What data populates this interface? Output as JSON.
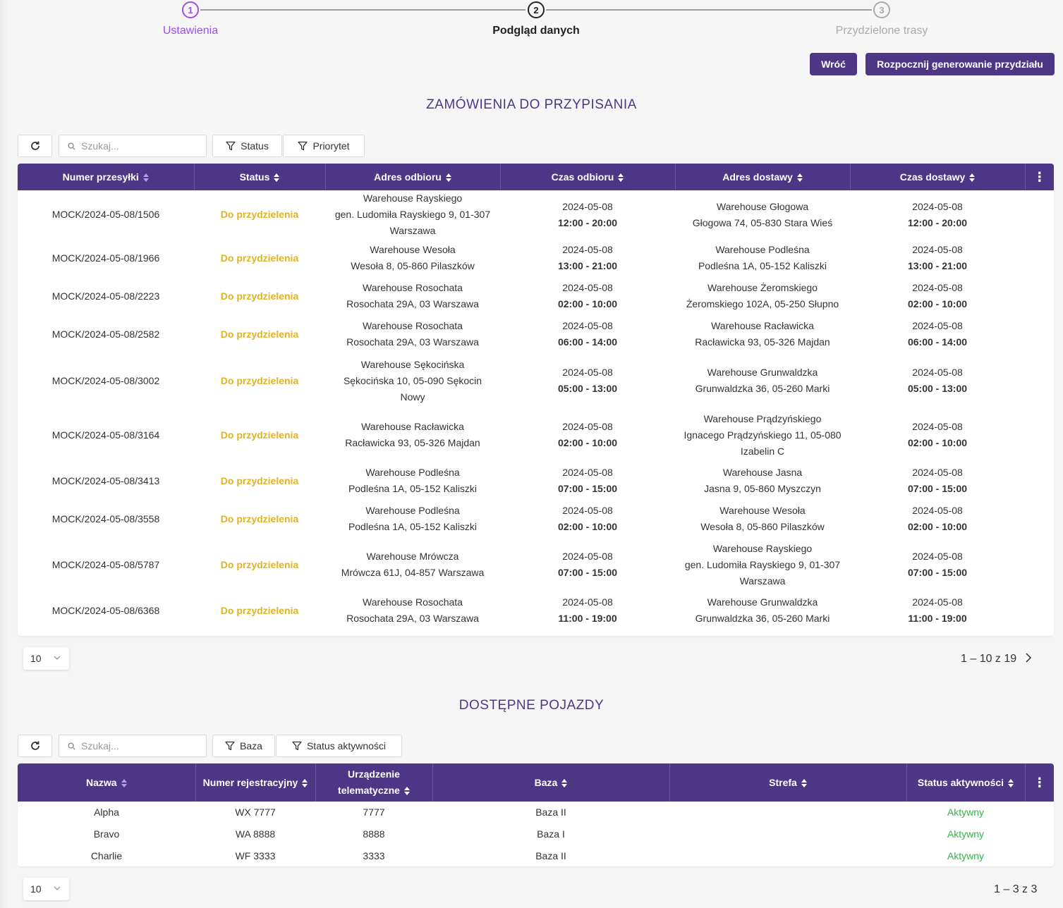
{
  "stepper": {
    "steps": [
      {
        "number": "1",
        "label": "Ustawienia",
        "state": "done"
      },
      {
        "number": "2",
        "label": "Podgląd danych",
        "state": "current"
      },
      {
        "number": "3",
        "label": "Przydzielone trasy",
        "state": "upcoming"
      }
    ]
  },
  "actions": {
    "back_label": "Wróć",
    "start_label": "Rozpocznij generowanie przydziału"
  },
  "orders": {
    "title": "ZAMÓWIENIA DO PRZYPISANIA",
    "search_placeholder": "Szukaj...",
    "filters": [
      "Status",
      "Priorytet"
    ],
    "columns": [
      "Numer przesyłki",
      "Status",
      "Adres odbioru",
      "Czas odbioru",
      "Adres dostawy",
      "Czas dostawy"
    ],
    "rows": [
      {
        "id": "MOCK/2024-05-08/1506",
        "status": "Do przydzielenia",
        "pickup_address": [
          "Warehouse Rayskiego",
          "gen. Ludomiła Rayskiego 9, 01-307",
          "Warszawa"
        ],
        "pickup_date": "2024-05-08",
        "pickup_time": "12:00 - 20:00",
        "delivery_address": [
          "Warehouse Głogowa",
          "Głogowa 74, 05-830 Stara Wieś"
        ],
        "delivery_date": "2024-05-08",
        "delivery_time": "12:00 - 20:00"
      },
      {
        "id": "MOCK/2024-05-08/1966",
        "status": "Do przydzielenia",
        "pickup_address": [
          "Warehouse Wesoła",
          "Wesoła 8, 05-860 Pilaszków"
        ],
        "pickup_date": "2024-05-08",
        "pickup_time": "13:00 - 21:00",
        "delivery_address": [
          "Warehouse Podleśna",
          "Podleśna 1A, 05-152 Kaliszki"
        ],
        "delivery_date": "2024-05-08",
        "delivery_time": "13:00 - 21:00"
      },
      {
        "id": "MOCK/2024-05-08/2223",
        "status": "Do przydzielenia",
        "pickup_address": [
          "Warehouse Rosochata",
          "Rosochata 29A, 03 Warszawa"
        ],
        "pickup_date": "2024-05-08",
        "pickup_time": "02:00 - 10:00",
        "delivery_address": [
          "Warehouse Żeromskiego",
          "Żeromskiego 102A, 05-250 Słupno"
        ],
        "delivery_date": "2024-05-08",
        "delivery_time": "02:00 - 10:00"
      },
      {
        "id": "MOCK/2024-05-08/2582",
        "status": "Do przydzielenia",
        "pickup_address": [
          "Warehouse Rosochata",
          "Rosochata 29A, 03 Warszawa"
        ],
        "pickup_date": "2024-05-08",
        "pickup_time": "06:00 - 14:00",
        "delivery_address": [
          "Warehouse Racławicka",
          "Racławicka 93, 05-326 Majdan"
        ],
        "delivery_date": "2024-05-08",
        "delivery_time": "06:00 - 14:00"
      },
      {
        "id": "MOCK/2024-05-08/3002",
        "status": "Do przydzielenia",
        "pickup_address": [
          "Warehouse Sękocińska",
          "Sękocińska 10, 05-090 Sękocin",
          "Nowy"
        ],
        "pickup_date": "2024-05-08",
        "pickup_time": "05:00 - 13:00",
        "delivery_address": [
          "Warehouse Grunwaldzka",
          "Grunwaldzka 36, 05-260 Marki"
        ],
        "delivery_date": "2024-05-08",
        "delivery_time": "05:00 - 13:00"
      },
      {
        "id": "MOCK/2024-05-08/3164",
        "status": "Do przydzielenia",
        "pickup_address": [
          "Warehouse Racławicka",
          "Racławicka 93, 05-326 Majdan"
        ],
        "pickup_date": "2024-05-08",
        "pickup_time": "02:00 - 10:00",
        "delivery_address": [
          "Warehouse Prądzyńskiego",
          "Ignacego Prądzyńskiego 11, 05-080",
          "Izabelin C"
        ],
        "delivery_date": "2024-05-08",
        "delivery_time": "02:00 - 10:00"
      },
      {
        "id": "MOCK/2024-05-08/3413",
        "status": "Do przydzielenia",
        "pickup_address": [
          "Warehouse Podleśna",
          "Podleśna 1A, 05-152 Kaliszki"
        ],
        "pickup_date": "2024-05-08",
        "pickup_time": "07:00 - 15:00",
        "delivery_address": [
          "Warehouse Jasna",
          "Jasna 9, 05-860 Myszczyn"
        ],
        "delivery_date": "2024-05-08",
        "delivery_time": "07:00 - 15:00"
      },
      {
        "id": "MOCK/2024-05-08/3558",
        "status": "Do przydzielenia",
        "pickup_address": [
          "Warehouse Podleśna",
          "Podleśna 1A, 05-152 Kaliszki"
        ],
        "pickup_date": "2024-05-08",
        "pickup_time": "02:00 - 10:00",
        "delivery_address": [
          "Warehouse Wesoła",
          "Wesoła 8, 05-860 Pilaszków"
        ],
        "delivery_date": "2024-05-08",
        "delivery_time": "02:00 - 10:00"
      },
      {
        "id": "MOCK/2024-05-08/5787",
        "status": "Do przydzielenia",
        "pickup_address": [
          "Warehouse Mrówcza",
          "Mrówcza 61J, 04-857 Warszawa"
        ],
        "pickup_date": "2024-05-08",
        "pickup_time": "07:00 - 15:00",
        "delivery_address": [
          "Warehouse Rayskiego",
          "gen. Ludomiła Rayskiego 9, 01-307",
          "Warszawa"
        ],
        "delivery_date": "2024-05-08",
        "delivery_time": "07:00 - 15:00"
      },
      {
        "id": "MOCK/2024-05-08/6368",
        "status": "Do przydzielenia",
        "pickup_address": [
          "Warehouse Rosochata",
          "Rosochata 29A, 03 Warszawa"
        ],
        "pickup_date": "2024-05-08",
        "pickup_time": "11:00 - 19:00",
        "delivery_address": [
          "Warehouse Grunwaldzka",
          "Grunwaldzka 36, 05-260 Marki"
        ],
        "delivery_date": "2024-05-08",
        "delivery_time": "11:00 - 19:00"
      }
    ],
    "page_size": "10",
    "page_info": "1 – 10 z 19"
  },
  "vehicles": {
    "title": "DOSTĘPNE POJAZDY",
    "search_placeholder": "Szukaj...",
    "filters": [
      "Baza",
      "Status aktywności"
    ],
    "columns": [
      "Nazwa",
      "Numer rejestracyjny",
      "Urządzenie telematyczne",
      "Baza",
      "Strefa",
      "Status aktywności"
    ],
    "rows": [
      {
        "name": "Alpha",
        "registration": "WX 7777",
        "telematics": "7777",
        "base": "Baza II",
        "zone": "",
        "status": "Aktywny"
      },
      {
        "name": "Bravo",
        "registration": "WA 8888",
        "telematics": "8888",
        "base": "Baza I",
        "zone": "",
        "status": "Aktywny"
      },
      {
        "name": "Charlie",
        "registration": "WF 3333",
        "telematics": "3333",
        "base": "Baza II",
        "zone": "",
        "status": "Aktywny"
      }
    ],
    "page_size": "10",
    "page_info": "1 – 3 z 3"
  },
  "colors": {
    "primary": "#4e3687",
    "step_done": "#9c4dec",
    "status_pending": "#e0b320",
    "status_active": "#36b34a"
  },
  "icons": [
    "refresh-icon",
    "search-icon",
    "filter-icon",
    "sort-icon",
    "kebab-menu-icon",
    "chevron-down-icon",
    "chevron-right-icon"
  ]
}
